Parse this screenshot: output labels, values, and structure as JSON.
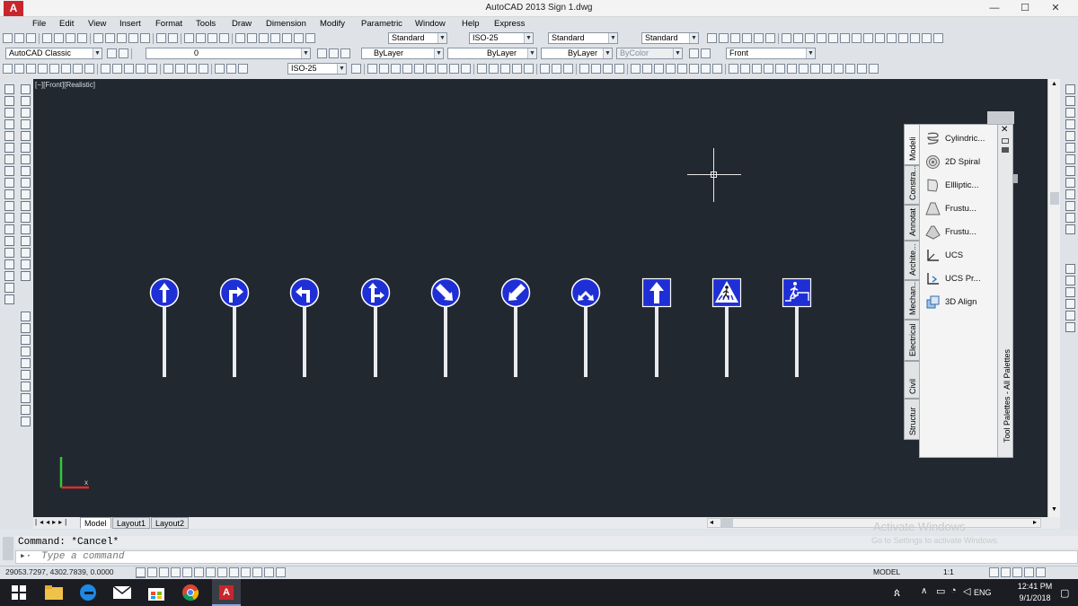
{
  "window": {
    "title": "AutoCAD 2013    Sign 1.dwg",
    "logo_text": "A",
    "minimize": "—",
    "maximize": "☐",
    "close": "✕"
  },
  "menu": [
    "File",
    "Edit",
    "View",
    "Insert",
    "Format",
    "Tools",
    "Draw",
    "Dimension",
    "Modify",
    "Parametric",
    "Window",
    "Help",
    "Express"
  ],
  "toolbar1": {
    "text_style": "Standard",
    "dim_style": "ISO-25",
    "table_style": "Standard",
    "mleader_style": "Standard"
  },
  "toolbar2": {
    "workspace": "AutoCAD Classic",
    "layer": "0",
    "color": "ByLayer",
    "linetype": "ByLayer",
    "lineweight": "ByLayer",
    "plotstyle": "ByColor",
    "view": "Front"
  },
  "toolbar3": {
    "dim_style": "ISO-25"
  },
  "viewport": {
    "label": "[−][Front][Realistic]",
    "background": "#212830"
  },
  "signs": [
    {
      "shape": "circle",
      "symbol": "arrow-up"
    },
    {
      "shape": "circle",
      "symbol": "turn-right"
    },
    {
      "shape": "circle",
      "symbol": "turn-left"
    },
    {
      "shape": "circle",
      "symbol": "straight-or-right"
    },
    {
      "shape": "circle",
      "symbol": "keep-right"
    },
    {
      "shape": "circle",
      "symbol": "keep-left"
    },
    {
      "shape": "circle",
      "symbol": "pass-either-side"
    },
    {
      "shape": "square",
      "symbol": "one-way-up"
    },
    {
      "shape": "square",
      "symbol": "pedestrian-crossing"
    },
    {
      "shape": "square",
      "symbol": "pedestrian-subway"
    }
  ],
  "sign_color": "#1f2fd6",
  "palette": {
    "title": "Tool Palettes - All Palettes",
    "tabs": [
      "Modeli",
      "Constra...",
      "Annotat",
      "Archite...",
      "Mechan...",
      "Electrical",
      "Civil",
      "Structur"
    ],
    "items": [
      {
        "label": "Cylindric...",
        "icon": "helix-icon"
      },
      {
        "label": "2D Spiral",
        "icon": "spiral-icon"
      },
      {
        "label": "Ellliptic...",
        "icon": "elliptic-cylinder-icon"
      },
      {
        "label": "Frustu...",
        "icon": "frustum-cone-icon"
      },
      {
        "label": "Frustu...",
        "icon": "frustum-pyramid-icon"
      },
      {
        "label": "UCS",
        "icon": "ucs-icon"
      },
      {
        "label": "UCS Pr...",
        "icon": "ucs-previous-icon"
      },
      {
        "label": "3D Align",
        "icon": "3d-align-icon"
      }
    ],
    "close": "✕"
  },
  "layout_tabs": [
    "Model",
    "Layout1",
    "Layout2"
  ],
  "command": {
    "history": "Command: *Cancel*",
    "placeholder": "Type a command"
  },
  "status": {
    "coords": "29053.7297, 4302.7839, 0.0000",
    "model": "MODEL",
    "scale": "1:1"
  },
  "taskbar": {
    "time": "12:41 PM",
    "date": "9/1/2018",
    "lang": "ENG"
  },
  "watermark": {
    "line1": "Activate Windows",
    "line2": "Go to Settings to activate Windows."
  }
}
